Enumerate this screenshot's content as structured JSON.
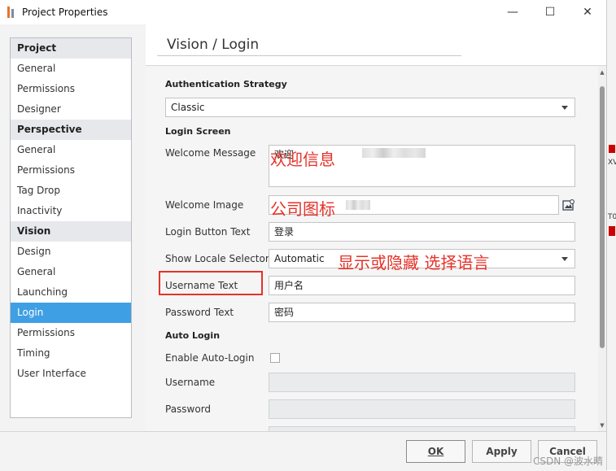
{
  "window": {
    "title": "Project Properties",
    "minimize": "—",
    "maximize": "☐",
    "close": "✕"
  },
  "sidebar": {
    "sections": [
      {
        "label": "Project",
        "items": [
          "General",
          "Permissions",
          "Designer"
        ]
      },
      {
        "label": "Perspective",
        "items": [
          "General",
          "Permissions",
          "Tag Drop",
          "Inactivity"
        ]
      },
      {
        "label": "Vision",
        "items": [
          "Design",
          "General",
          "Launching",
          "Login",
          "Permissions",
          "Timing",
          "User Interface"
        ]
      }
    ],
    "active_item": "Login"
  },
  "page": {
    "title": "Vision / Login"
  },
  "form": {
    "auth_group": "Authentication Strategy",
    "auth_strategy_value": "Classic",
    "login_screen_group": "Login Screen",
    "welcome_message_label": "Welcome Message",
    "welcome_message_value": "欢迎",
    "welcome_image_label": "Welcome Image",
    "login_button_text_label": "Login Button Text",
    "login_button_text_value": "登录",
    "show_locale_selector_label": "Show Locale Selector",
    "show_locale_selector_value": "Automatic",
    "username_text_label": "Username Text",
    "username_text_value": "用户名",
    "password_text_label": "Password Text",
    "password_text_value": "密码",
    "auto_login_group": "Auto Login",
    "enable_auto_login_label": "Enable Auto-Login",
    "username_label": "Username",
    "password_label": "Password"
  },
  "annotations": {
    "welcome_message": "欢迎信息",
    "welcome_image": "公司图标",
    "locale_selector": "显示或隐藏 选择语言"
  },
  "footer": {
    "ok": "OK",
    "apply": "Apply",
    "cancel": "Cancel"
  },
  "background_window": {
    "fragment_1": "XV",
    "fragment_2": "T0"
  },
  "watermark": "CSDN @波水晴",
  "colors": {
    "accent": "#3f9fe4",
    "annotation_red": "#e5332a"
  }
}
